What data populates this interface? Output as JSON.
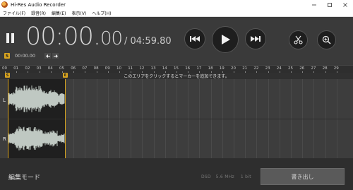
{
  "window": {
    "title": "Hi-Res Audio Recorder",
    "minimize_icon": "minimize-icon",
    "maximize_icon": "maximize-icon",
    "close_icon": "close-icon"
  },
  "menu": {
    "items": [
      "ファイル(F)",
      "録音(R)",
      "編集(E)",
      "表示(V)",
      "ヘルプ(H)"
    ]
  },
  "transport": {
    "time_big": "00:00.",
    "time_small": "00",
    "time_total": "/ 04:59.80",
    "marker_start_badge": "S",
    "marker_time": "00:00.00",
    "buttons": [
      "rewind-icon",
      "play-icon",
      "fast-forward-icon",
      "scissors-icon",
      "zoom-in-icon"
    ]
  },
  "ruler": {
    "ticks": [
      "00",
      "01",
      "02",
      "03",
      "04",
      "05",
      "06",
      "07",
      "08",
      "09",
      "10",
      "11",
      "12",
      "13",
      "14",
      "15",
      "16",
      "17",
      "18",
      "19",
      "20",
      "21",
      "22",
      "23",
      "24",
      "25",
      "26",
      "27",
      "28",
      "29"
    ]
  },
  "hint_text": "このエリアをクリックするとマーカーを追加できます。",
  "tracks": {
    "left_label": "L",
    "right_label": "R",
    "start_marker": "S",
    "end_marker": "E"
  },
  "bottom": {
    "mode_label": "編集モード",
    "format_dsd": "DSD",
    "format_rate": "5.6 MHz",
    "format_bits": "1 bit",
    "export_label": "書き出し"
  },
  "colors": {
    "accent": "#d9a520",
    "background": "#2a2a2a",
    "waveform": "#bfc8c2"
  }
}
